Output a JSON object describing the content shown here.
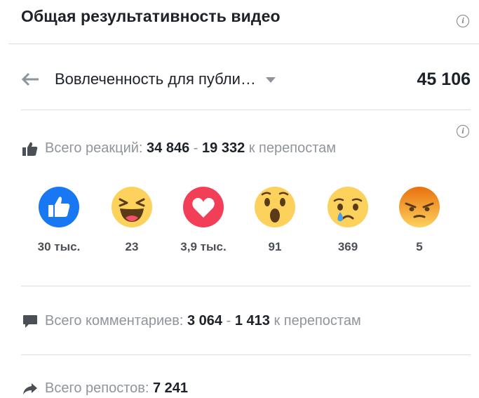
{
  "header": {
    "title": "Общая результативность видео",
    "info_icon": "info-icon"
  },
  "engagement": {
    "back_icon": "arrow-left-icon",
    "dropdown_label": "Вовлеченность для публи…",
    "total": "45 106"
  },
  "reactions": {
    "icon": "thumbs-up-icon",
    "label": "Всего реакций:",
    "total": "34 846",
    "separator": "-",
    "shares_total": "19 332",
    "shares_label": "к перепостам",
    "items": [
      {
        "type": "like",
        "count": "30 тыс."
      },
      {
        "type": "haha",
        "count": "23"
      },
      {
        "type": "love",
        "count": "3,9 тыс."
      },
      {
        "type": "wow",
        "count": "91"
      },
      {
        "type": "sad",
        "count": "369"
      },
      {
        "type": "angry",
        "count": "5"
      }
    ]
  },
  "comments": {
    "icon": "comment-icon",
    "label": "Всего комментариев:",
    "total": "3 064",
    "separator": "-",
    "shares_total": "1 413",
    "shares_label": "к перепостам"
  },
  "shares": {
    "icon": "share-arrow-icon",
    "label": "Всего репостов:",
    "total": "7 241"
  },
  "colors": {
    "like_blue": "#1877f2",
    "love_red": "#f33e58",
    "emoji_yellow": "#fcd25c",
    "angry_orange": "#e9710f",
    "muted_text": "#90949c"
  }
}
